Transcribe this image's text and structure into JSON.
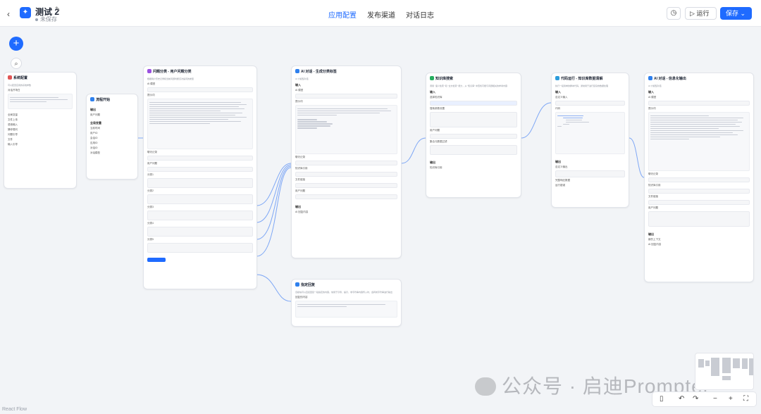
{
  "header": {
    "back_icon": "chevron-left-icon",
    "app_icon_glyph": "✦",
    "app_title": "测试 2",
    "edit_icon": "edit-icon",
    "status": "未保存",
    "tabs": [
      {
        "label": "应用配置",
        "active": true
      },
      {
        "label": "发布渠道",
        "active": false
      },
      {
        "label": "对话日志",
        "active": false
      }
    ],
    "history_icon": "clock-icon",
    "run_label": "运行",
    "save_label": "保存"
  },
  "canvas": {
    "add_glyph": "+",
    "search_glyph": "⌕",
    "watermark": "公众号 · 启迪Prompter",
    "react_flow": "React Flow"
  },
  "nodes": [
    {
      "id": "system",
      "title": "系统配置",
      "color": "#e05555",
      "desc": "可以配置应用的系统参数",
      "lines": [
        "对话开场白",
        "全局变量",
        "文件上传",
        "语音输入",
        "猜你想问",
        "问题引导",
        "文件",
        "输入引导"
      ]
    },
    {
      "id": "start",
      "title": "流程开始",
      "color": "#2f80ed",
      "desc": "",
      "lines": [
        "输出",
        "用户问题",
        "全局变量",
        "当前时间",
        "用户ID",
        "会话ID",
        "应用ID",
        "对话ID",
        "对话模型"
      ]
    },
    {
      "id": "classify",
      "title": "问题分类 - 用户问题分类",
      "color": "#9b51e0",
      "desc": "根据用户历史记录和当前问题判断该次提问的类型",
      "lines": [
        "AI 模型",
        "提示词",
        "聊天记录",
        "用户问题",
        "分类1",
        "分类2",
        "分类3",
        "分类4",
        "分类5",
        "添加问题类型"
      ]
    },
    {
      "id": "chat1",
      "title": "AI 对话 - 生成分类标签",
      "color": "#2f80ed",
      "desc": "AI 大模型对话",
      "lines": [
        "输入",
        "AI 模型",
        "提示词",
        "聊天记录",
        "知识库引用",
        "文件链接",
        "用户问题",
        "输出",
        "AI 回复内容"
      ]
    },
    {
      "id": "knowledge",
      "title": "知识库搜索",
      "color": "#27ae60",
      "desc": "调用 “语义检索” 和 “全文检索” 能力，从 “知识库” 中查找可能与问题相关的参考内容",
      "lines": [
        "输入",
        "选择知识库",
        "搜索参数设置",
        "用户问题",
        "集合元数据过滤",
        "输出",
        "知识库引用"
      ]
    },
    {
      "id": "code",
      "title": "代码运行 - 知识库数据清解",
      "color": "#2d9cdb",
      "desc": "执行一段简单的脚本代码，通常用于进行复杂的数据处理",
      "lines": [
        "输入",
        "自定义输入",
        "代码",
        "输出",
        "自定义输出",
        "完整响应数据",
        "运行错误"
      ]
    },
    {
      "id": "reply",
      "title": "指定回复",
      "color": "#2f80ed",
      "desc": "该模块可以直接回复一段指定的内容，常用于引导、提示，非字符串内容传入时，会转成字符串进行输出",
      "lines": [
        "回复的内容"
      ]
    },
    {
      "id": "chat2",
      "title": "AI 对话 - 信息化输出",
      "color": "#2f80ed",
      "desc": "AI 大模型对话",
      "lines": [
        "输入",
        "AI 模型",
        "提示词",
        "聊天记录",
        "知识库引用",
        "文件链接",
        "用户问题",
        "输出",
        "新的上下文",
        "AI 回复内容"
      ]
    }
  ]
}
